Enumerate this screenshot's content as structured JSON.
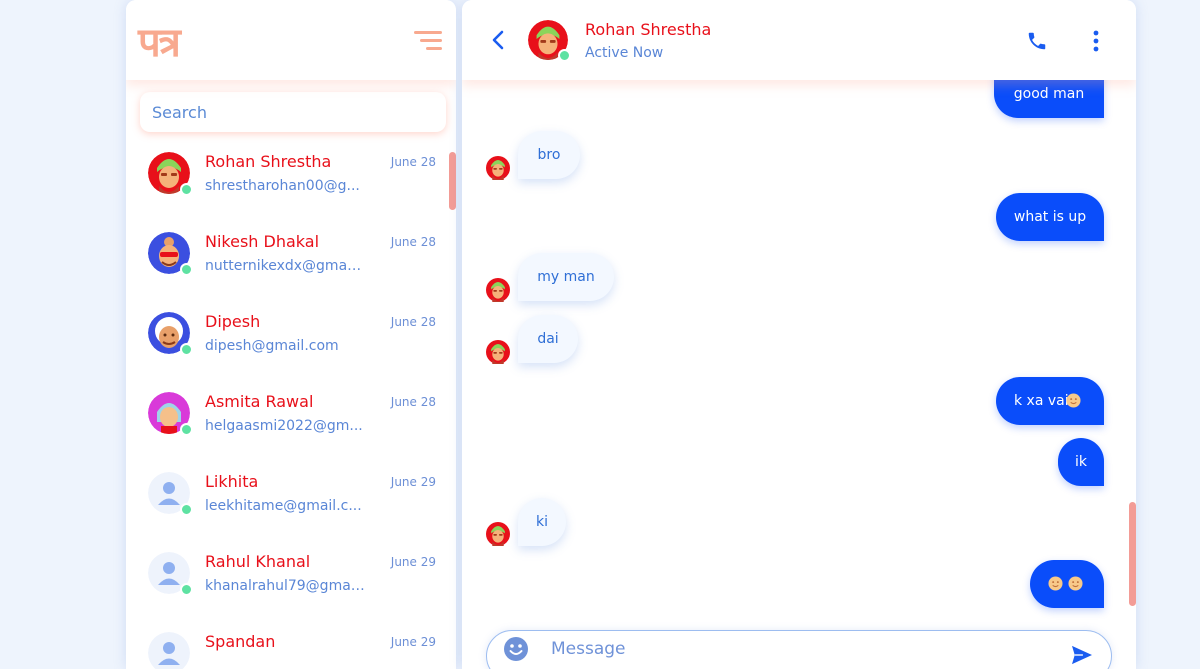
{
  "app": {
    "logo_text": "पत्र"
  },
  "search": {
    "placeholder": "Search"
  },
  "contacts": [
    {
      "name": "Rohan Shrestha",
      "email": "shrestharohan00@g...",
      "date": "June 28"
    },
    {
      "name": "Nikesh Dhakal",
      "email": "nutternikexdx@gmail....",
      "date": "June 28"
    },
    {
      "name": "Dipesh",
      "email": "dipesh@gmail.com",
      "date": "June 28"
    },
    {
      "name": "Asmita Rawal",
      "email": "helgaasmi2022@gm...",
      "date": "June 28"
    },
    {
      "name": "Likhita",
      "email": "leekhitame@gmail.c...",
      "date": "June 29"
    },
    {
      "name": "Rahul Khanal",
      "email": "khanalrahul79@gmai...",
      "date": "June 29"
    },
    {
      "name": "Spandan",
      "email": "",
      "date": "June 29"
    }
  ],
  "chat": {
    "name": "Rohan Shrestha",
    "status": "Active Now",
    "messages": [
      {
        "from": "me",
        "text": "good man"
      },
      {
        "from": "them",
        "text": "bro"
      },
      {
        "from": "me",
        "text": "what is up"
      },
      {
        "from": "them",
        "text": "my man"
      },
      {
        "from": "them",
        "text": "dai"
      },
      {
        "from": "me",
        "text": "k xa vai"
      },
      {
        "from": "me",
        "text": "ik"
      },
      {
        "from": "them",
        "text": "ki"
      },
      {
        "from": "me",
        "text": ""
      }
    ]
  },
  "composer": {
    "placeholder": "Message"
  },
  "colors": {
    "accent": "#0a4dfa",
    "name": "#e8101a",
    "secondary_text": "#5a86d6",
    "logo": "#f8a98f",
    "online": "#5ee2a2",
    "scrollbar": "#f39c96"
  },
  "icons": [
    "menu-icon",
    "back-icon",
    "phone-icon",
    "more-vertical-icon",
    "emoji-icon",
    "send-icon",
    "smile-emoji-icon"
  ]
}
